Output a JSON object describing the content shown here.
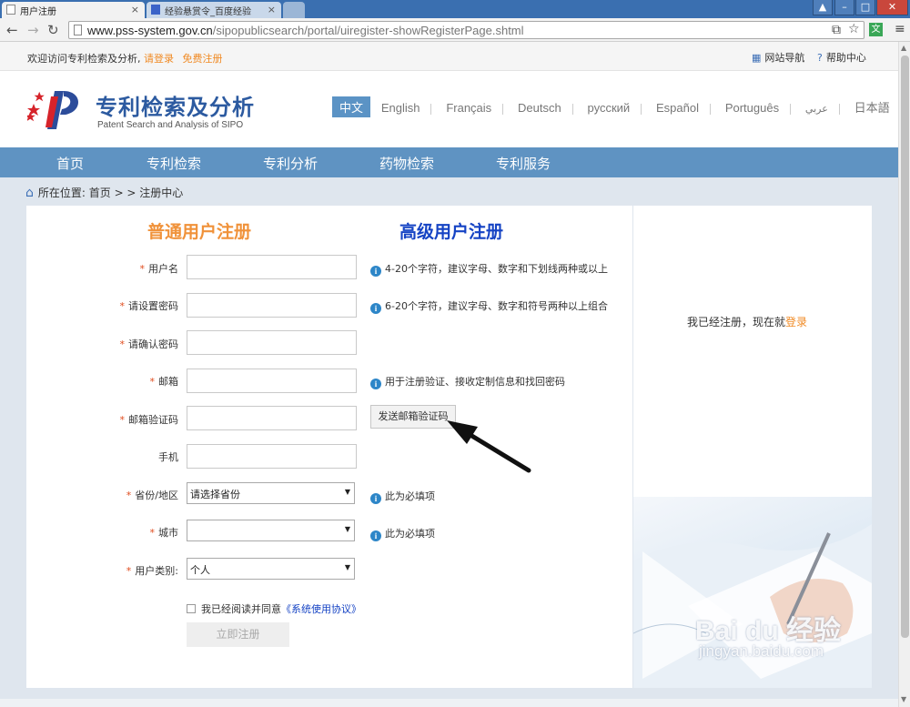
{
  "browser": {
    "tabs": [
      {
        "label": "用户注册",
        "close": "×"
      },
      {
        "label": "经验悬赏令_百度经验",
        "close": "×"
      }
    ],
    "url_host": "www.pss-system.gov.cn",
    "url_path": "/sipopublicsearch/portal/uiregister-showRegisterPage.shtml",
    "translate_ext": "文",
    "window_buttons": [
      "–",
      "□",
      "✕"
    ]
  },
  "topbar": {
    "welcome": "欢迎访问专利检索及分析,",
    "login": "请登录",
    "register": "免费注册",
    "site_nav": "网站导航",
    "help": "帮助中心"
  },
  "header": {
    "title": "专利检索及分析",
    "subtitle": "Patent Search and Analysis of SIPO",
    "languages": [
      "中文",
      "English",
      "Français",
      "Deutsch",
      "русский",
      "Español",
      "Português",
      "عربي",
      "日本語"
    ]
  },
  "nav": [
    "首页",
    "专利检索",
    "专利分析",
    "药物检索",
    "专利服务"
  ],
  "breadcrumb": "所在位置: 首页 > > 注册中心",
  "tabs": {
    "normal": "普通用户注册",
    "advanced": "高级用户注册"
  },
  "form": {
    "username": {
      "label": "用户名",
      "hint": "4-20个字符，建议字母、数字和下划线两种或以上"
    },
    "password": {
      "label": "请设置密码",
      "hint": "6-20个字符，建议字母、数字和符号两种以上组合"
    },
    "confirm": {
      "label": "请确认密码"
    },
    "email": {
      "label": "邮箱",
      "hint": "用于注册验证、接收定制信息和找回密码"
    },
    "email_code": {
      "label": "邮箱验证码",
      "button": "发送邮箱验证码"
    },
    "phone": {
      "label": "手机"
    },
    "province": {
      "label": "省份/地区",
      "value": "请选择省份",
      "hint": "此为必填项"
    },
    "city": {
      "label": "城市",
      "value": "",
      "hint": "此为必填项"
    },
    "user_type": {
      "label": "用户类别:",
      "value": "个人"
    },
    "agree_text": "我已经阅读并同意",
    "agree_link": "《系统使用协议》",
    "submit": "立即注册"
  },
  "side": {
    "already": "我已经注册，现在就",
    "login": "登录"
  },
  "watermark": {
    "brand": "Bai du 经验",
    "url": "jingyan.baidu.com"
  },
  "colors": {
    "nav": "#5f93c2",
    "orange": "#f08a24",
    "blue_title": "#1543c4",
    "required": "#e04b1d"
  }
}
